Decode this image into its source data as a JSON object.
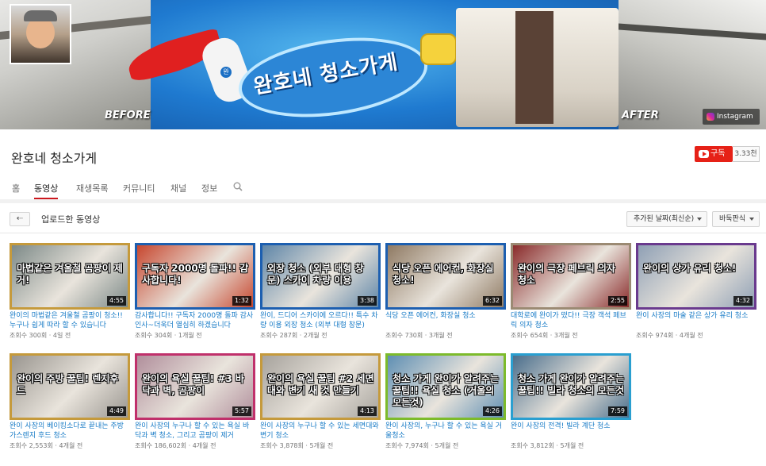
{
  "banner": {
    "before_label": "BEFORE",
    "after_label": "AFTER",
    "title_art": "완호네 청소가게",
    "social_label": "Instagram",
    "hero_badge": "완"
  },
  "channel": {
    "name": "완호네 청소가게",
    "subscribe_label": "구독",
    "subscriber_count": "3.33천"
  },
  "tabs": [
    {
      "label": "홈"
    },
    {
      "label": "동영상"
    },
    {
      "label": "재생목록"
    },
    {
      "label": "커뮤니티"
    },
    {
      "label": "채널"
    },
    {
      "label": "정보"
    }
  ],
  "section": {
    "title": "업로드한 동영상",
    "sort_label": "추가된 날짜(최신순)",
    "view_label": "바둑판식"
  },
  "videos": [
    {
      "thumb_text": "마법같은 겨울철 곰팡이 제거!",
      "duration": "4:55",
      "title": "완이의 마법같은 겨울철 곰팡이 청소!! 누구나 쉽게 따라 할 수 있습니다",
      "views": "조회수 300회",
      "age": "4일 전",
      "border": "#c59a3c",
      "bg": "#7d8a88"
    },
    {
      "thumb_text": "구독자 2000명 돌파!! 감사합니다!",
      "duration": "1:32",
      "title": "감사합니다!! 구독자 2000명 돌파 감사인사~더욱더 열심히 하겠습니다",
      "views": "조회수 304회",
      "age": "1개월 전",
      "border": "#1d5fb0",
      "bg": "#c7472f"
    },
    {
      "thumb_text": "외장 청소 (외부 대형 창문) 스카이 차량 이용",
      "duration": "3:38",
      "title": "완이, 드디어 스카이에 오르다!! 특수 차량 이용 외장 청소 (외부 대형 창문)",
      "views": "조회수 287회",
      "age": "2개월 전",
      "border": "#1d5fb0",
      "bg": "#5f86a8"
    },
    {
      "thumb_text": "식당 오픈 에어컨, 화장실 청소!",
      "duration": "6:32",
      "title": "식당 오픈 에어컨, 화장실 청소",
      "views": "조회수 730회",
      "age": "3개월 전",
      "border": "#1d5fb0",
      "bg": "#8f7a63"
    },
    {
      "thumb_text": "완이의 극장 페브릭 의자 청소",
      "duration": "2:55",
      "title": "대학로에 완이가 떴다!! 극장 객석 페브릭 의자 청소",
      "views": "조회수 654회",
      "age": "3개월 전",
      "border": "#9b8a73",
      "bg": "#8a2b2b"
    },
    {
      "thumb_text": "완이의 상가 유리 청소!",
      "duration": "4:32",
      "title": "완이 사장의 마술 같은 상가 유리 청소",
      "views": "조회수 974회",
      "age": "4개월 전",
      "border": "#6a3a8e",
      "bg": "#8fa0b5"
    },
    {
      "thumb_text": "완이의 주방 꿀팁! 렌지후드",
      "duration": "4:49",
      "title": "완이 사장의 베이킹소다로 끝내는 주방 가스렌지 후드 청소",
      "views": "조회수 2,553회",
      "age": "4개월 전",
      "border": "#c59a3c",
      "bg": "#9a9690"
    },
    {
      "thumb_text": "완이의 욕실 꿀팁! #3 바닥과 벽, 곰팡이",
      "duration": "5:57",
      "title": "완이 사장의 누구나 할 수 있는 욕실 바닥과 벽 청소, 그리고 곰팡이 제거",
      "views": "조회수 186,602회",
      "age": "4개월 전",
      "border": "#c0306b",
      "bg": "#b18f9c"
    },
    {
      "thumb_text": "완이의 욕실 꿀팁 #2 세면대와 변기 새 것 만들기",
      "duration": "4:13",
      "title": "완이 사장의 누구나 할 수 있는 세면대와 변기 청소",
      "views": "조회수 3,878회",
      "age": "5개월 전",
      "border": "#c59a3c",
      "bg": "#a7a39d"
    },
    {
      "thumb_text": "청소 가게 완이가 알려주는 꿀팁!! 욕실 청소 (거울의 모든것)",
      "duration": "4:26",
      "title": "완이 사장의, 누구나 할 수 있는 욕실 거울청소",
      "views": "조회수 7,974회",
      "age": "5개월 전",
      "border": "#7dbb2b",
      "bg": "#5f8fb3"
    },
    {
      "thumb_text": "청소 가게 완이가 알려주는 꿀팁!! 빌라 청소의 모든것",
      "duration": "7:59",
      "title": "완이 사장의 전격! 빌라 계단 청소",
      "views": "조회수 3,812회",
      "age": "5개월 전",
      "border": "#2a9fd0",
      "bg": "#4a6e8c"
    }
  ],
  "colors": {
    "accent": "#cc181e",
    "link": "#167ac6",
    "subscribe": "#e62117"
  }
}
